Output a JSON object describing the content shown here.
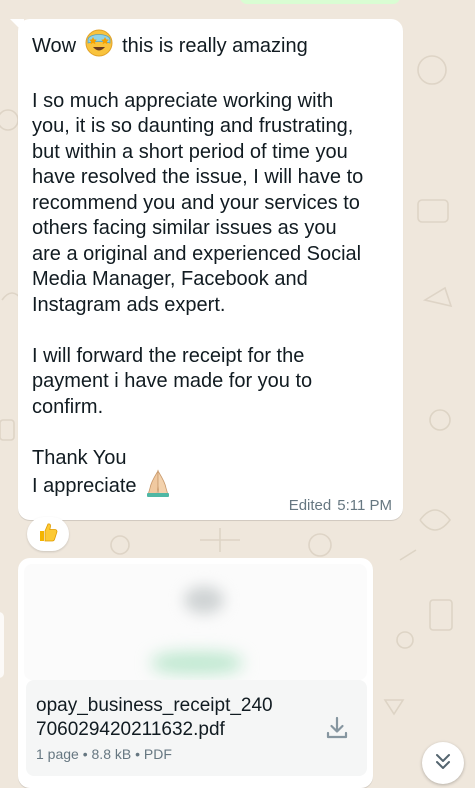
{
  "message": {
    "first_line_before": "Wow",
    "first_line_after": "this is really amazing",
    "first_emoji_icon": "star-struck-face",
    "paragraph1": [
      "I so much appreciate working with",
      "you, it is so daunting and frustrating,",
      "but within a short period of time you",
      "have resolved the issue, I will have to",
      "recommend you and your services to",
      "others facing similar issues as you",
      "are a original and experienced Social",
      "Media Manager, Facebook and",
      "Instagram ads expert."
    ],
    "paragraph2": [
      "I will forward the receipt for the",
      "payment i have made for you to",
      "confirm."
    ],
    "thanks": "Thank You",
    "appreciate": "I appreciate",
    "appreciate_emoji_icon": "folded-hands",
    "edited_label": "Edited",
    "time": "5:11 PM"
  },
  "reaction": {
    "icon": "thumbs-up"
  },
  "document": {
    "filename_line1": "opay_business_receipt_240",
    "filename_line2": "706029420211632.pdf",
    "pages": "1 page",
    "size": "8.8 kB",
    "type": "PDF",
    "separator": "•",
    "download_icon": "download-icon"
  },
  "scroll_button": {
    "icon": "double-chevron-down"
  },
  "colors": {
    "wallpaper": "#efe7dc",
    "bubble": "#ffffff",
    "meta_text": "#667781",
    "outgoing_bubble": "#d9fdd3"
  }
}
